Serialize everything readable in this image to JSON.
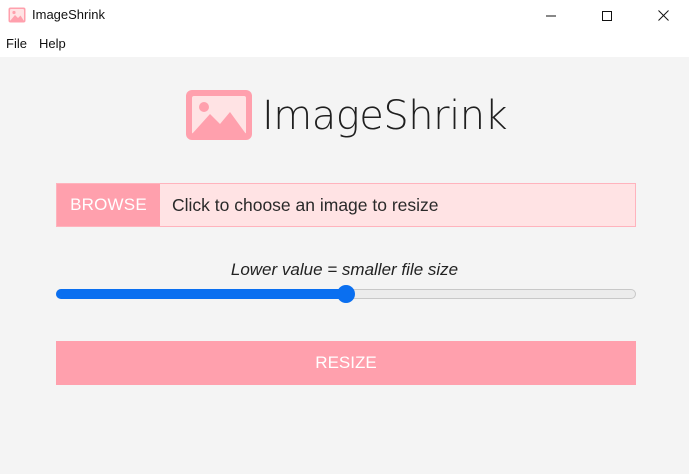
{
  "window": {
    "title": "ImageShrink",
    "icon": "image-icon",
    "controls": [
      "minimize-icon",
      "maximize-icon",
      "close-icon"
    ]
  },
  "menu": {
    "items": [
      {
        "label": "File"
      },
      {
        "label": "Help"
      }
    ]
  },
  "header": {
    "logo_icon": "image-icon",
    "title": "ImageShrink"
  },
  "file_picker": {
    "browse_label": "BROWSE",
    "prompt": "Click to choose an image to resize"
  },
  "quality": {
    "label": "Lower value = smaller file size",
    "value_fraction": 0.5
  },
  "actions": {
    "resize_label": "RESIZE"
  },
  "colors": {
    "accent_pink": "#ffa0ad",
    "input_bg": "#ffe3e4",
    "slider_blue": "#0a6ff0",
    "background": "#f4f4f4"
  }
}
